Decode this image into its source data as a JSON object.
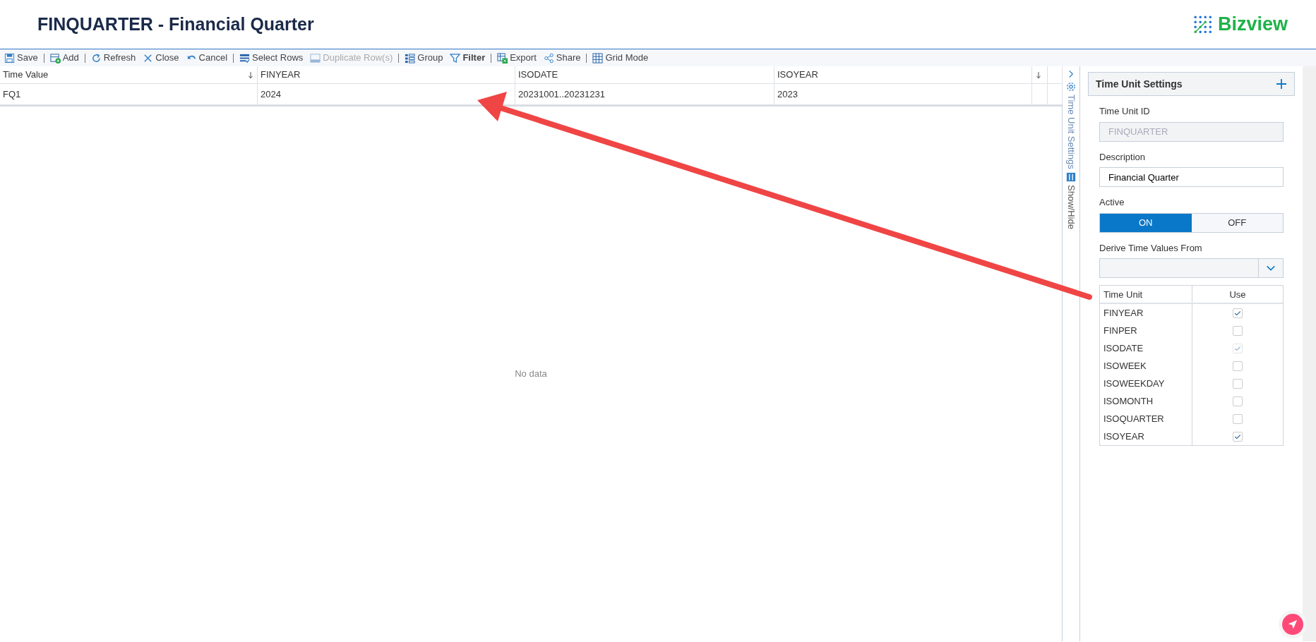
{
  "header": {
    "title": "FINQUARTER - Financial Quarter",
    "logo_text": "Bizview"
  },
  "toolbar": [
    {
      "kind": "button",
      "label": "Save",
      "disabled": false,
      "emphasized": false
    },
    {
      "kind": "separator"
    },
    {
      "kind": "button",
      "label": "Add",
      "disabled": false,
      "emphasized": false
    },
    {
      "kind": "separator"
    },
    {
      "kind": "button",
      "label": "Refresh",
      "disabled": false,
      "emphasized": false
    },
    {
      "kind": "button",
      "label": "Close",
      "disabled": false,
      "emphasized": false
    },
    {
      "kind": "button",
      "label": "Cancel",
      "disabled": false,
      "emphasized": false
    },
    {
      "kind": "separator"
    },
    {
      "kind": "button",
      "label": "Select Rows",
      "disabled": false,
      "emphasized": false
    },
    {
      "kind": "button",
      "label": "Duplicate Row(s)",
      "disabled": true,
      "emphasized": false
    },
    {
      "kind": "separator"
    },
    {
      "kind": "button",
      "label": "Group",
      "disabled": false,
      "emphasized": false
    },
    {
      "kind": "button",
      "label": "Filter",
      "disabled": false,
      "emphasized": true
    },
    {
      "kind": "separator"
    },
    {
      "kind": "button",
      "label": "Export",
      "disabled": false,
      "emphasized": false
    },
    {
      "kind": "button",
      "label": "Share",
      "disabled": false,
      "emphasized": false
    },
    {
      "kind": "separator"
    },
    {
      "kind": "button",
      "label": "Grid Mode",
      "disabled": false,
      "emphasized": false
    }
  ],
  "table": {
    "columns": [
      {
        "label": "Time Value",
        "sorted": true
      },
      {
        "label": "FINYEAR",
        "sorted": false
      },
      {
        "label": "ISODATE",
        "sorted": false
      },
      {
        "label": "ISOYEAR",
        "sorted": false
      },
      {
        "sorted": true
      }
    ],
    "rows": [
      [
        "FQ1",
        "2024",
        "20231001..20231231",
        "2023"
      ]
    ],
    "empty_text": "No data"
  },
  "side_strip": [
    {
      "kind": "collapse"
    },
    {
      "kind": "settings",
      "label": "Time Unit Settings"
    },
    {
      "kind": "columns",
      "label": "Show/Hide"
    }
  ],
  "panel": {
    "title": "Time Unit Settings",
    "fields": [
      {
        "kind": "text",
        "label": "Time Unit ID",
        "value": "FINQUARTER",
        "disabled": true
      },
      {
        "kind": "text",
        "label": "Description",
        "value": "Financial Quarter",
        "disabled": false
      },
      {
        "kind": "toggle",
        "label": "Active",
        "options": [
          {
            "label": "ON",
            "selected": true
          },
          {
            "label": "OFF",
            "selected": false
          }
        ]
      },
      {
        "kind": "select",
        "label": "Derive Time Values From"
      }
    ],
    "units_table": {
      "columns": [
        "Time Unit",
        "Use"
      ],
      "rows": [
        {
          "name": "FINYEAR",
          "checked": true,
          "disabled": false
        },
        {
          "name": "FINPER",
          "checked": false,
          "disabled": false
        },
        {
          "name": "ISODATE",
          "checked": true,
          "disabled": true
        },
        {
          "name": "ISOWEEK",
          "checked": false,
          "disabled": false
        },
        {
          "name": "ISOWEEKDAY",
          "checked": false,
          "disabled": false
        },
        {
          "name": "ISOMONTH",
          "checked": false,
          "disabled": false
        },
        {
          "name": "ISOQUARTER",
          "checked": false,
          "disabled": false
        },
        {
          "name": "ISOYEAR",
          "checked": true,
          "disabled": false
        }
      ]
    }
  },
  "annotation": {
    "kind": "arrow"
  }
}
